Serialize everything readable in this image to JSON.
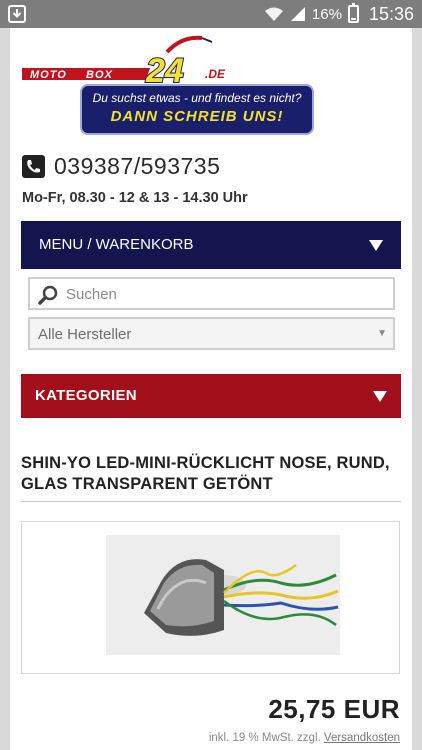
{
  "status_bar": {
    "battery": "16%",
    "time": "15:36",
    "battery_level": 0.16,
    "icons": [
      "download-icon",
      "wifi-icon",
      "signal-icon",
      "battery-icon"
    ]
  },
  "header": {
    "logo_text": "MOTOBOX24.DE",
    "banner_line1": "Du suchst etwas - und findest es nicht?",
    "banner_line2": "DANN SCHREIB UNS!",
    "phone": "039387/593735",
    "hours": "Mo-Fr, 08.30 - 12 & 13 - 14.30 Uhr"
  },
  "menu": {
    "label": "MENU / WARENKORB"
  },
  "search": {
    "placeholder": "Suchen"
  },
  "manufacturer_select": {
    "selected": "Alle Hersteller"
  },
  "categories": {
    "label": "KATEGORIEN"
  },
  "product": {
    "title": "SHIN-YO LED-MINI-RÜCKLICHT NOSE, RUND, GLAS TRANSPARENT GETÖNT",
    "price": "25,75 EUR",
    "vat_prefix": "inkl. 19 % MwSt. zzgl.",
    "shipping_link": "Versandkosten"
  },
  "colors": {
    "menu_bg": "#14154f",
    "categories_bg": "#a1101a",
    "banner_bg": "#1a1f6b",
    "banner_accent": "#f4e12a"
  }
}
